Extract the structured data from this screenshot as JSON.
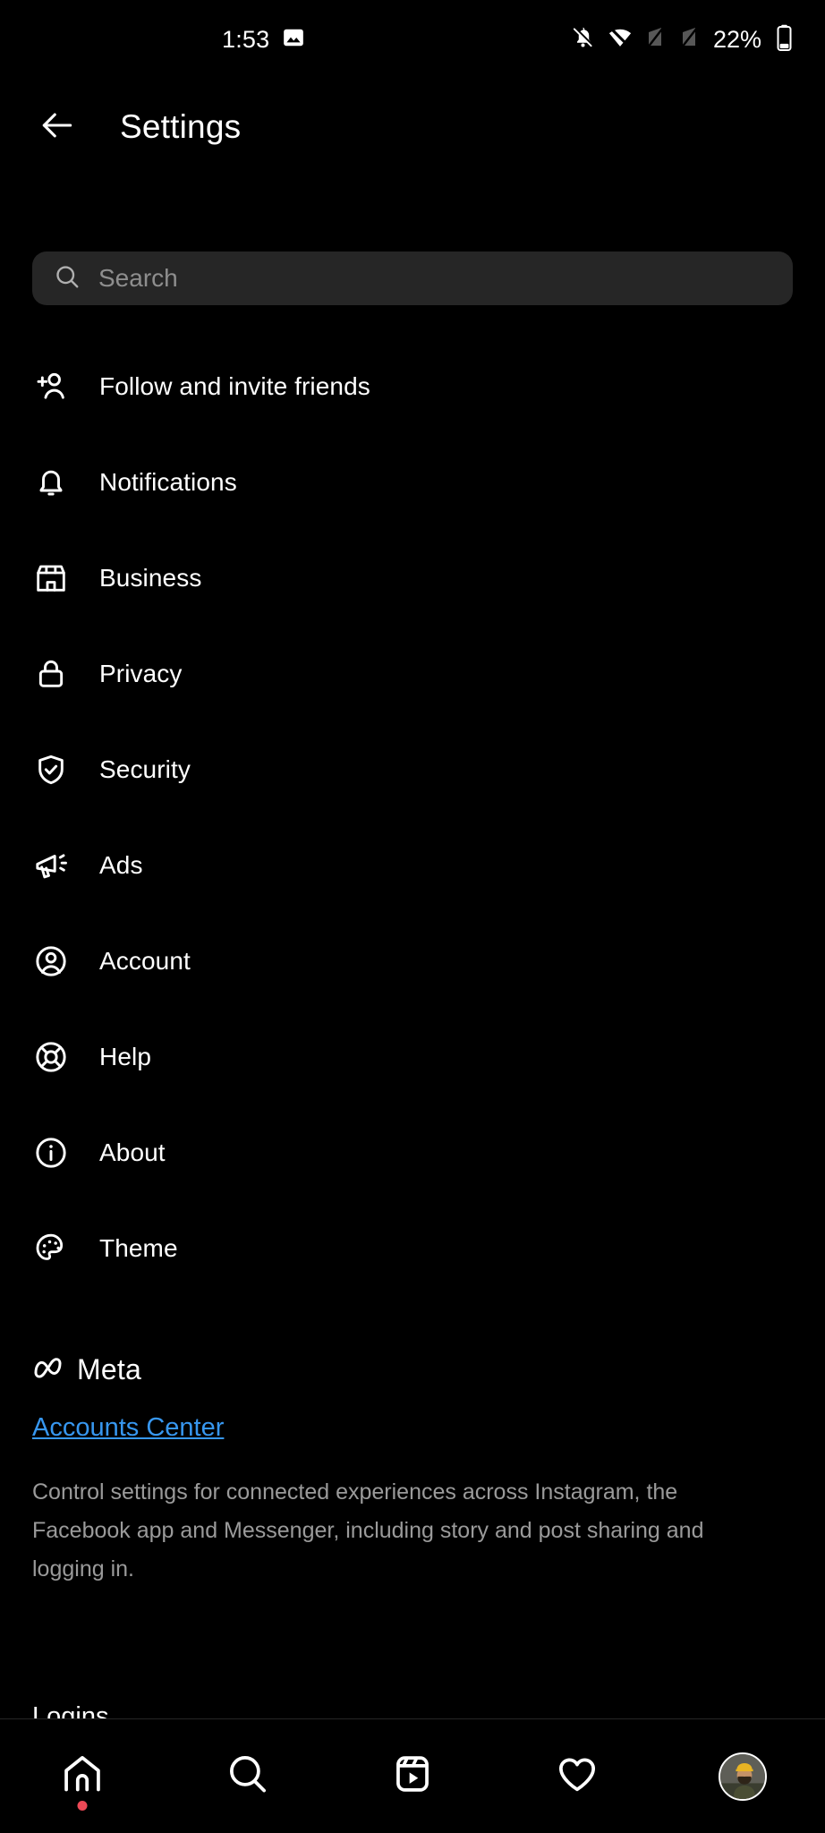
{
  "statusbar": {
    "time": "1:53",
    "battery_percent": "22%",
    "icons": [
      "image-icon",
      "bell-muted-icon",
      "wifi-icon",
      "signal-bar-inactive-icon",
      "signal-bar-inactive-icon",
      "battery-icon"
    ]
  },
  "header": {
    "title": "Settings",
    "back_icon": "arrow-left-icon"
  },
  "search": {
    "placeholder": "Search",
    "value": "",
    "icon": "search-icon"
  },
  "menu": {
    "items": [
      {
        "label": "Follow and invite friends",
        "icon": "person-add-icon"
      },
      {
        "label": "Notifications",
        "icon": "bell-icon"
      },
      {
        "label": "Business",
        "icon": "storefront-icon"
      },
      {
        "label": "Privacy",
        "icon": "lock-icon"
      },
      {
        "label": "Security",
        "icon": "shield-check-icon"
      },
      {
        "label": "Ads",
        "icon": "megaphone-icon"
      },
      {
        "label": "Account",
        "icon": "user-circle-icon"
      },
      {
        "label": "Help",
        "icon": "lifebuoy-icon"
      },
      {
        "label": "About",
        "icon": "info-circle-icon"
      },
      {
        "label": "Theme",
        "icon": "palette-icon"
      }
    ]
  },
  "meta_section": {
    "brand": "Meta",
    "brand_icon": "meta-infinity-icon",
    "link": "Accounts Center",
    "description": "Control settings for connected experiences across Instagram, the Facebook app and Messenger, including story and post sharing and logging in.",
    "next_section": "Logins"
  },
  "bottom_nav": {
    "items": [
      {
        "name": "home",
        "icon": "home-icon",
        "badge": true
      },
      {
        "name": "search",
        "icon": "search-icon",
        "badge": false
      },
      {
        "name": "reels",
        "icon": "reels-icon",
        "badge": false
      },
      {
        "name": "activity",
        "icon": "heart-icon",
        "badge": false
      },
      {
        "name": "profile",
        "icon": "avatar-icon",
        "badge": false
      }
    ]
  },
  "colors": {
    "background": "#000000",
    "search_field": "#262626",
    "link_blue": "#3797f0",
    "muted_text": "#9a9a9a",
    "placeholder": "#8e8e8e",
    "badge_red": "#ed4956"
  }
}
